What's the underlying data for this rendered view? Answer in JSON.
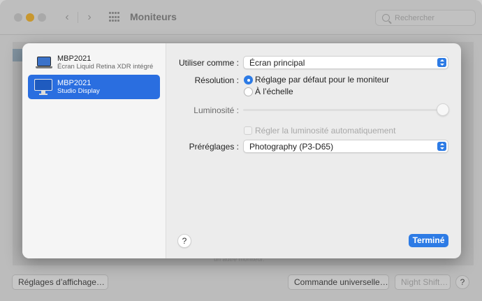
{
  "window": {
    "title": "Moniteurs",
    "search_placeholder": "Rechercher",
    "back_glyph": "‹",
    "forward_glyph": "›",
    "help_glyph": "?"
  },
  "background": {
    "caption": "un autre moniteur.",
    "buttons": {
      "display_settings": "Réglages d’affichage…",
      "universal_control": "Commande universelle…",
      "night_shift": "Night Shift…"
    }
  },
  "sheet": {
    "displays": [
      {
        "name": "MBP2021",
        "subtitle": "Écran Liquid Retina XDR intégré",
        "icon": "laptop-icon",
        "selected": false
      },
      {
        "name": "MBP2021",
        "subtitle": "Studio Display",
        "icon": "monitor-icon",
        "selected": true
      }
    ],
    "use_as": {
      "label": "Utiliser comme :",
      "value": "Écran principal"
    },
    "resolution": {
      "label": "Résolution :",
      "options": [
        {
          "label": "Réglage par défaut pour le moniteur",
          "selected": true
        },
        {
          "label": "À l’échelle",
          "selected": false
        }
      ]
    },
    "brightness": {
      "label": "Luminosité :",
      "level": 1.0
    },
    "auto_brightness": {
      "label": "Régler la luminosité automatiquement",
      "checked": false,
      "enabled": false
    },
    "presets": {
      "label": "Préréglages :",
      "value": "Photography (P3-D65)"
    },
    "help_glyph": "?",
    "done_label": "Terminé"
  },
  "colors": {
    "accent": "#2d7be5",
    "selection": "#2a6ee0",
    "minimize": "#f5b93a"
  }
}
